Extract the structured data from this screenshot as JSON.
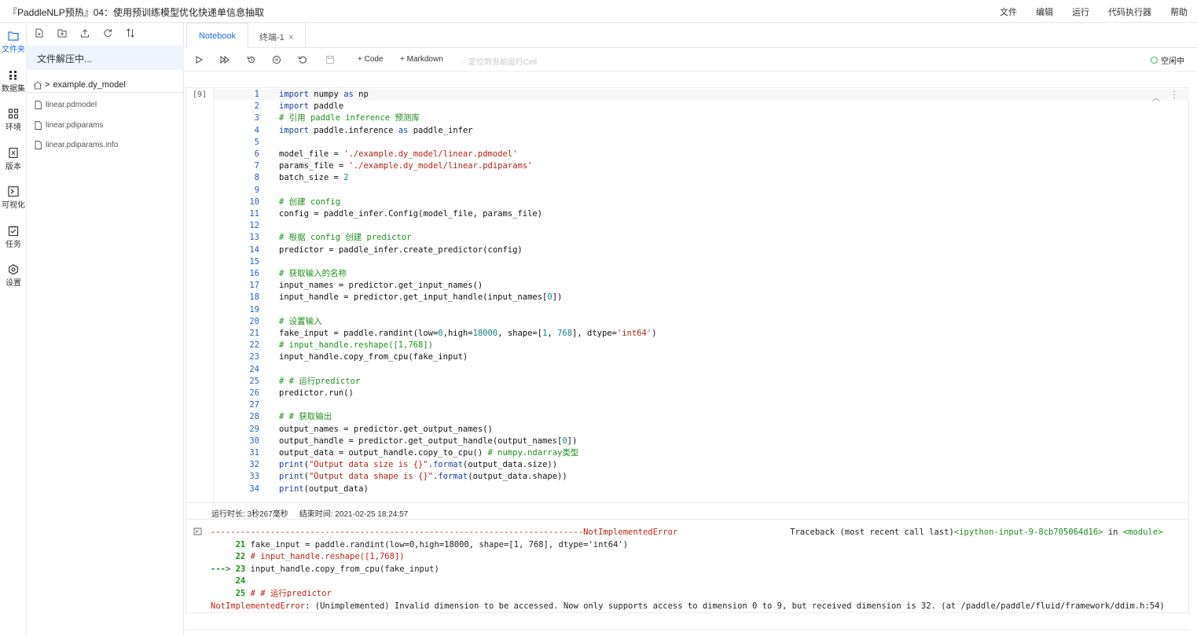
{
  "window": {
    "title": "『PaddleNLP预热』04：使用预训练模型优化快递单信息抽取",
    "menu": [
      "文件",
      "编辑",
      "运行",
      "代码执行器",
      "帮助"
    ]
  },
  "activity_bar": {
    "items": [
      {
        "label": "文件夹",
        "icon": "folder-icon",
        "active": true
      },
      {
        "label": "数据集",
        "icon": "dataset-icon",
        "active": false
      },
      {
        "label": "环境",
        "icon": "environment-icon",
        "active": false
      },
      {
        "label": "版本",
        "icon": "version-icon",
        "active": false
      },
      {
        "label": "可视化",
        "icon": "visualization-icon",
        "active": false
      },
      {
        "label": "任务",
        "icon": "task-icon",
        "active": false
      },
      {
        "label": "设置",
        "icon": "settings-icon",
        "active": false
      }
    ],
    "accent_color": "#2468f2"
  },
  "file_panel": {
    "toolbar_icons": [
      "new-file-icon",
      "new-folder-icon",
      "upload-icon",
      "refresh-icon",
      "sort-icon"
    ],
    "status": "文件解压中...",
    "breadcrumb": {
      "home_icon": "home-icon",
      "separator": ">",
      "folder": "example.dy_model"
    },
    "files": [
      "linear.pdmodel",
      "linear.pdiparams",
      "linear.pdiparams.info"
    ]
  },
  "tabs": [
    {
      "label": "Notebook",
      "active": true
    },
    {
      "label": "终端-1",
      "active": false,
      "close": "×"
    }
  ],
  "notebook_toolbar": {
    "icons": [
      "run-icon",
      "run-all-icon",
      "restart-icon",
      "interrupt-icon",
      "restart-run-icon",
      "save-icon"
    ],
    "add_code": "Code",
    "add_markdown": "Markdown",
    "locate_cell": "定位到当前运行Cell",
    "kernel_status": "空闲中",
    "kernel_status_color": "#3bb273"
  },
  "cell": {
    "prompt": "[9]",
    "line_numbers": [
      "1",
      "2",
      "3",
      "4",
      "5",
      "6",
      "7",
      "8",
      "9",
      "10",
      "11",
      "12",
      "13",
      "14",
      "15",
      "16",
      "17",
      "18",
      "19",
      "20",
      "21",
      "22",
      "23",
      "24",
      "25",
      "26",
      "27",
      "28",
      "29",
      "30",
      "31",
      "32",
      "33",
      "34"
    ],
    "run_info": {
      "duration": "运行时长: 3秒267毫秒",
      "end_time": "结束时间: 2021-02-25 18:24:57"
    }
  },
  "output": {
    "icon": "output-icon",
    "dash_line": "---------------------------------------------------------------------------",
    "error_name": "NotImplementedError",
    "traceback_label": "Traceback (most recent call last)",
    "traceback_location": "<ipython-input-9-8cb705064d16>",
    "in_word": " in ",
    "module": "<module>",
    "tb_lines": [
      {
        "marker": "     21",
        "code": " fake_input = paddle.randint(low=0,high=18000, shape=[1, 768], dtype='int64')"
      },
      {
        "marker": "     22",
        "code": " # input_handle.reshape([1,768])"
      },
      {
        "marker": "---> 23",
        "code": " input_handle.copy_from_cpu(fake_input)"
      },
      {
        "marker": "     24",
        "code": ""
      },
      {
        "marker": "     25",
        "code": " # # 运行predictor"
      }
    ],
    "error_message": ": (Unimplemented) Invalid dimension to be accessed. Now only supports access to dimension 0 to 9, but received dimension is 32. (at /paddle/paddle/fluid/framework/ddim.h:54)"
  }
}
